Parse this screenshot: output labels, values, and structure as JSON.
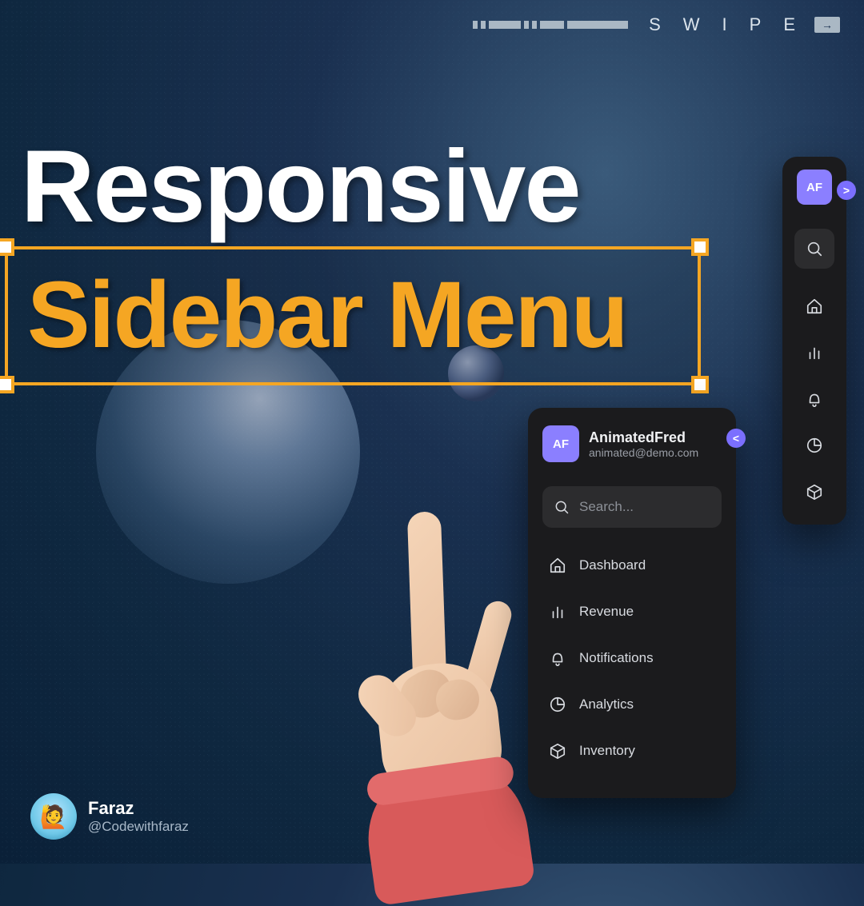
{
  "swipe_label": "SWIPE",
  "title_line1": "Responsive",
  "title_line2": "Sidebar Menu",
  "author": {
    "name": "Faraz",
    "handle": "@Codewithfaraz"
  },
  "colors": {
    "accent": "#8b7fff",
    "highlight": "#f5a623",
    "bg_dark": "#1b1b1d"
  },
  "sidebar_collapsed": {
    "avatar_initials": "AF",
    "toggle_symbol": ">",
    "items": [
      {
        "id": "search",
        "icon": "search-icon"
      },
      {
        "id": "dashboard",
        "icon": "home-icon"
      },
      {
        "id": "revenue",
        "icon": "bars-icon"
      },
      {
        "id": "notifications",
        "icon": "bell-icon"
      },
      {
        "id": "analytics",
        "icon": "pie-icon"
      },
      {
        "id": "inventory",
        "icon": "box-icon"
      }
    ]
  },
  "sidebar_expanded": {
    "avatar_initials": "AF",
    "user_name": "AnimatedFred",
    "user_email": "animated@demo.com",
    "toggle_symbol": "<",
    "search_placeholder": "Search...",
    "items": [
      {
        "icon": "home-icon",
        "label": "Dashboard"
      },
      {
        "icon": "bars-icon",
        "label": "Revenue"
      },
      {
        "icon": "bell-icon",
        "label": "Notifications"
      },
      {
        "icon": "pie-icon",
        "label": "Analytics"
      },
      {
        "icon": "box-icon",
        "label": "Inventory"
      }
    ]
  }
}
